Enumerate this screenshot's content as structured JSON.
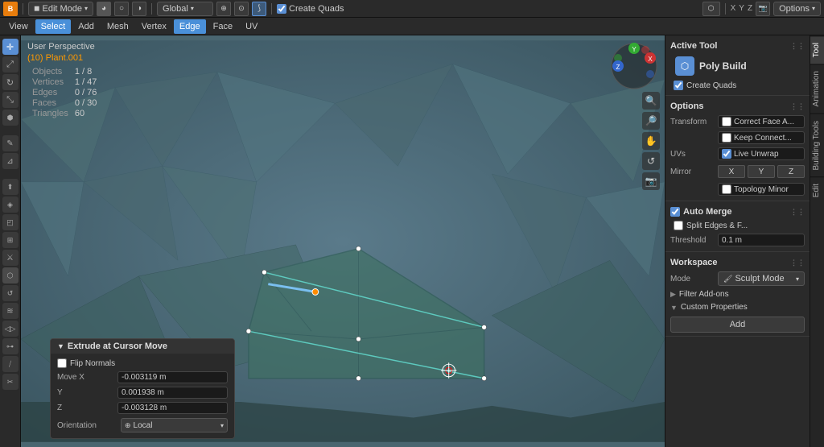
{
  "topbar": {
    "mode_label": "Edit Mode",
    "global_label": "Global",
    "create_quads_label": "Create Quads",
    "overlay_label": "Overlays",
    "icons": [
      "◨",
      "◫",
      "⬡"
    ]
  },
  "menubar": {
    "items": [
      "View",
      "Select",
      "Add",
      "Mesh",
      "Vertex",
      "Edge",
      "Face",
      "UV"
    ]
  },
  "viewport": {
    "perspective": "User Perspective",
    "object_name": "(10) Plant.001",
    "stats": [
      {
        "label": "Objects",
        "value": "1 / 8"
      },
      {
        "label": "Vertices",
        "value": "1 / 47"
      },
      {
        "label": "Edges",
        "value": "0 / 76"
      },
      {
        "label": "Faces",
        "value": "0 / 30"
      },
      {
        "label": "Triangles",
        "value": "60"
      }
    ]
  },
  "right_panel": {
    "tabs": [
      "Tool",
      "Animation",
      "Building Tools",
      "Edit"
    ],
    "active_tool": {
      "section_title": "Active Tool",
      "tool_name": "Poly Build",
      "tool_icon": "⬡",
      "create_quads": true,
      "create_quads_label": "Create Quads"
    },
    "options": {
      "section_title": "Options",
      "transform_label": "Transform",
      "correct_face_label": "Correct Face A...",
      "keep_connect_label": "Keep Connect...",
      "uvs_label": "UVs",
      "live_unwrap_label": "Live Unwrap",
      "live_unwrap": true,
      "mirror_label": "Mirror",
      "x_label": "X",
      "y_label": "Y",
      "z_label": "Z",
      "topology_minor_label": "Topology Minor"
    },
    "auto_merge": {
      "section_title": "Auto Merge",
      "enabled": true,
      "split_edges_label": "Split Edges & F...",
      "threshold_label": "Threshold",
      "threshold_value": "0.1 m"
    },
    "workspace": {
      "section_title": "Workspace",
      "mode_label": "Mode",
      "sculpt_mode_label": "Sculpt Mode",
      "filter_addons_label": "Filter Add-ons",
      "custom_props_label": "Custom Properties",
      "add_label": "Add"
    }
  },
  "extrude_panel": {
    "title": "Extrude at Cursor Move",
    "flip_normals_label": "Flip Normals",
    "flip_normals": false,
    "move_x_label": "Move X",
    "move_x_value": "-0.003119 m",
    "move_y_label": "Y",
    "move_y_value": "0.001938 m",
    "move_z_label": "Z",
    "move_z_value": "-0.003128 m",
    "orientation_label": "Orientation",
    "orientation_value": "Local"
  }
}
